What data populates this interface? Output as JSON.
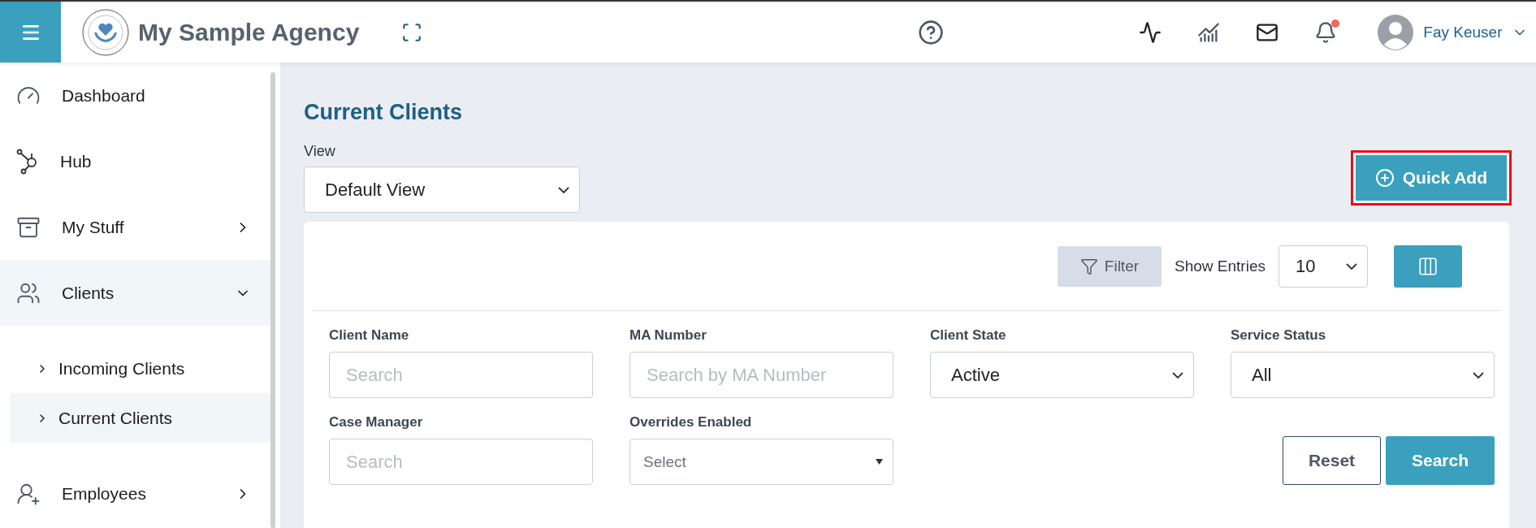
{
  "header": {
    "brand": "My Sample Agency",
    "user": "Fay Keuser",
    "notification_unread": true
  },
  "sidebar": {
    "items": [
      {
        "label": "Dashboard",
        "kind": "link",
        "selected": false
      },
      {
        "label": "Hub",
        "kind": "link",
        "selected": false
      },
      {
        "label": "My Stuff",
        "kind": "group",
        "selected": false,
        "expanded": false
      },
      {
        "label": "Clients",
        "kind": "group",
        "selected": true,
        "expanded": true,
        "children": [
          {
            "label": "Incoming Clients",
            "selected": false
          },
          {
            "label": "Current Clients",
            "selected": true
          }
        ]
      },
      {
        "label": "Employees",
        "kind": "group",
        "selected": false,
        "expanded": false
      }
    ]
  },
  "page": {
    "title": "Current Clients",
    "view": {
      "label": "View",
      "value": "Default View"
    },
    "quick_add": {
      "label": "Quick Add",
      "highlighted": true
    }
  },
  "toolbar": {
    "filter": "Filter",
    "show_entries": {
      "label": "Show Entries",
      "value": "10"
    }
  },
  "filters": [
    {
      "label": "Client Name",
      "kind": "text",
      "placeholder": "Search"
    },
    {
      "label": "MA Number",
      "kind": "text",
      "placeholder": "Search by MA Number"
    },
    {
      "label": "Client State",
      "kind": "select",
      "value": "Active"
    },
    {
      "label": "Service Status",
      "kind": "select",
      "value": "All"
    },
    {
      "label": "Case Manager",
      "kind": "text",
      "placeholder": "Search"
    },
    {
      "label": "Overrides Enabled",
      "kind": "dropdown",
      "placeholder": "Select"
    }
  ],
  "buttons": {
    "reset": "Reset",
    "search": "Search"
  }
}
